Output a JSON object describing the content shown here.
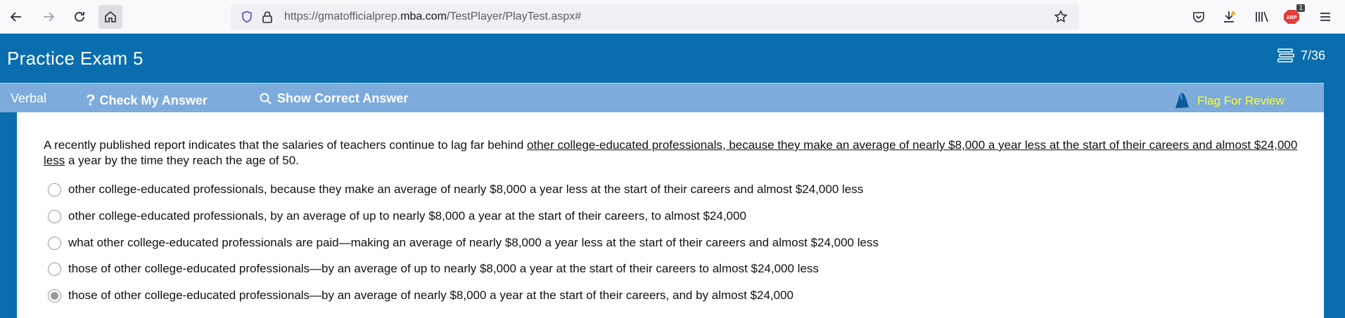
{
  "browser": {
    "url_prefix": "https://gmatofficialprep.",
    "url_domain": "mba.com",
    "url_path": "/TestPlayer/PlayTest.aspx#",
    "extension_badge": "1"
  },
  "header": {
    "title": "Practice Exam 5",
    "progress": "7/36"
  },
  "toolbar": {
    "section": "Verbal",
    "check_answer": "Check My Answer",
    "show_answer": "Show Correct Answer",
    "flag": "Flag For Review"
  },
  "question": {
    "stem_before": "A recently published report indicates that the salaries of teachers continue to lag far behind ",
    "stem_underlined": "other college-educated professionals, because they make an average of nearly $8,000 a year less at the start of their careers and almost $24,000 less",
    "stem_after": " a year by the time they reach the age of 50.",
    "options": [
      {
        "text": "other college-educated professionals, because they make an average of nearly $8,000 a year less at the start of their careers and almost $24,000 less",
        "selected": false
      },
      {
        "text": "other college-educated professionals, by an average of up to nearly $8,000 a year at the start of their careers, to almost $24,000",
        "selected": false
      },
      {
        "text": "what other college-educated professionals are paid—making an average of nearly $8,000 a year less at the start of their careers and almost $24,000 less",
        "selected": false
      },
      {
        "text": "those of other college-educated professionals—by an average of up to nearly $8,000 a year at the start of their careers to almost $24,000 less",
        "selected": false
      },
      {
        "text": "those of other college-educated professionals—by an average of nearly $8,000 a year at the start of their careers, and by almost $24,000",
        "selected": true
      }
    ]
  },
  "colors": {
    "header_blue": "#0a6eae",
    "toolbar_blue": "#7cabdc",
    "flag_yellow": "#ffff33"
  }
}
